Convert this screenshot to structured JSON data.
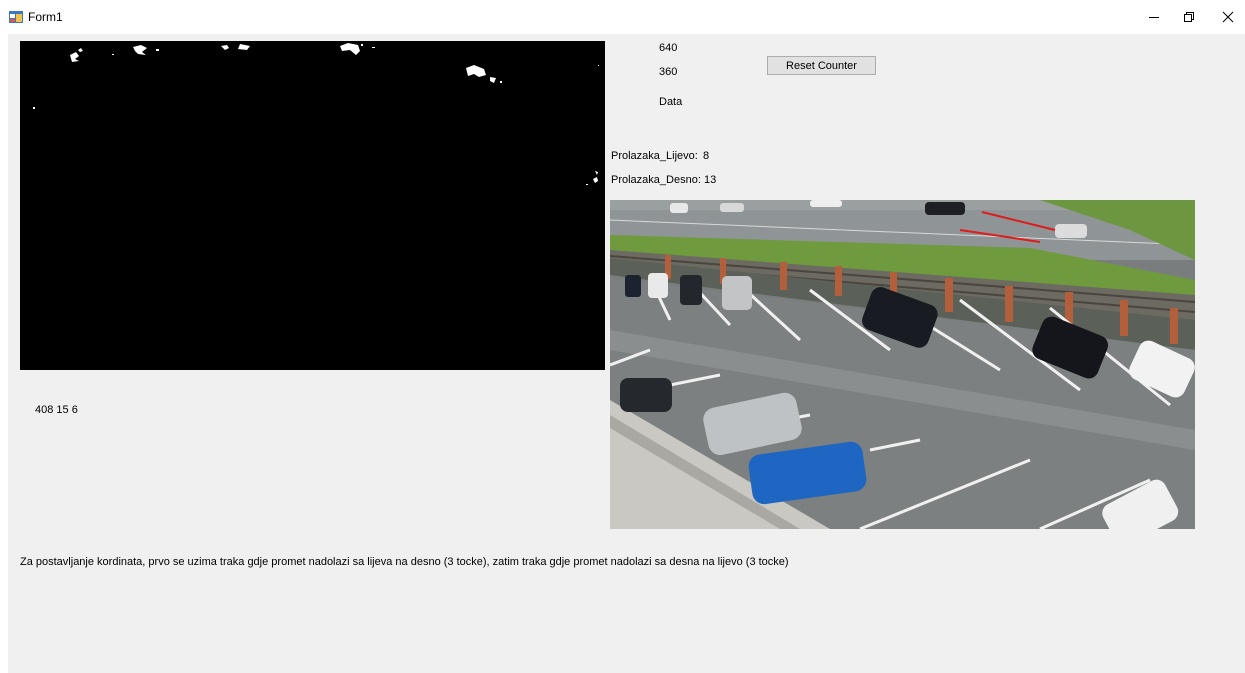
{
  "window": {
    "title": "Form1",
    "icon": "form-app-icon",
    "controls": [
      "minimize-icon",
      "restore-icon",
      "close-icon"
    ]
  },
  "left_panel": {
    "image": "binary-motion-mask",
    "values_label": "408 15 6"
  },
  "info": {
    "width": "640",
    "height": "360",
    "data_label": "Data",
    "reset_button": "Reset Counter",
    "left_label": "Prolazaka_Lijevo:",
    "left_count": "8",
    "right_label": "Prolazaka_Desno:",
    "right_count": "13"
  },
  "right_panel": {
    "image": "parking-lot-camera-frame"
  },
  "instructions": "Za postavljanje kordinata, prvo se uzima traka gdje promet nadolazi sa lijeva na desno (3 tocke), zatim traka gdje promet nadolazi sa desna na lijevo (3 tocke)"
}
